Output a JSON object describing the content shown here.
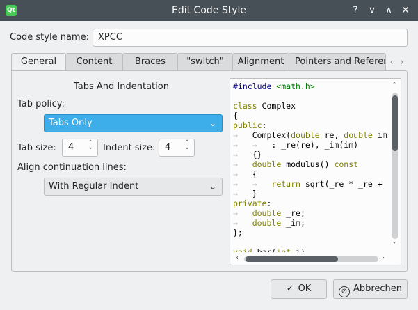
{
  "window": {
    "title": "Edit Code Style",
    "app_icon": "qt-icon",
    "app_icon_text": "Qt",
    "help": "?",
    "minimize": "∨",
    "maximize": "∧",
    "close": "✕"
  },
  "code_style_name": {
    "label": "Code style name:",
    "value": "XPCC"
  },
  "tabs": [
    {
      "label": "General",
      "active": true
    },
    {
      "label": "Content",
      "active": false
    },
    {
      "label": "Braces",
      "active": false
    },
    {
      "label": "\"switch\"",
      "active": false
    },
    {
      "label": "Alignment",
      "active": false
    },
    {
      "label": "Pointers and References",
      "active": false
    }
  ],
  "tab_scroll": {
    "left": "‹",
    "right": "›"
  },
  "general": {
    "section_title": "Tabs And Indentation",
    "tab_policy_label": "Tab policy:",
    "tab_policy_value": "Tabs Only",
    "tab_size_label": "Tab size:",
    "tab_size_value": "4",
    "indent_size_label": "Indent size:",
    "indent_size_value": "4",
    "align_label": "Align continuation lines:",
    "align_value": "With Regular Indent",
    "dropdown_arrow": "⌄",
    "spin_up": "˄",
    "spin_down": "˅"
  },
  "preview": {
    "lines": [
      "#include <math.h>",
      "",
      "class Complex",
      "{",
      "public:",
      "    Complex(double re, double im",
      "        : _re(re), _im(im)",
      "    {}",
      "    double modulus() const",
      "    {",
      "        return sqrt(_re * _re +",
      "    }",
      "private:",
      "    double _re;",
      "    double _im;",
      "};",
      "",
      "void bar(int i)"
    ],
    "scroll_up": "˄",
    "scroll_down": "˅",
    "scroll_left": "‹",
    "scroll_right": "›"
  },
  "buttons": {
    "ok": "OK",
    "ok_icon": "✓",
    "cancel": "Abbrechen",
    "cancel_icon": "⊘"
  },
  "colors": {
    "titlebar": "#475057",
    "accent": "#3daee9",
    "keyword": "#808000",
    "preprocessor": "#000080",
    "include_path": "#008000"
  }
}
